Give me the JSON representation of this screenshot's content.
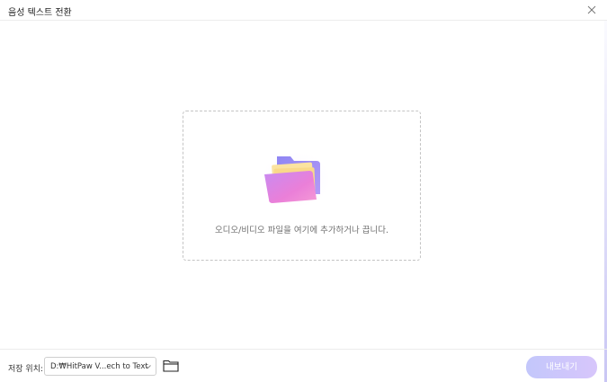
{
  "window": {
    "title": "음성 텍스트 전환",
    "close_icon": "close-icon"
  },
  "dropzone": {
    "icon": "folder-icon",
    "hint": "오디오/비디오 파일을 여기에 추가하거나 끕니다."
  },
  "footer": {
    "save_location_label": "저장 위치:",
    "save_path": "D:₩HitPaw V...ech to Text",
    "folder_icon": "folder-outline-icon",
    "export_label": "내보내기"
  },
  "colors": {
    "accent": "#c3c7fb",
    "folder_purple": "#8e85f0",
    "folder_pink": "#f07ed4",
    "folder_yellow": "#fbe3a0"
  }
}
